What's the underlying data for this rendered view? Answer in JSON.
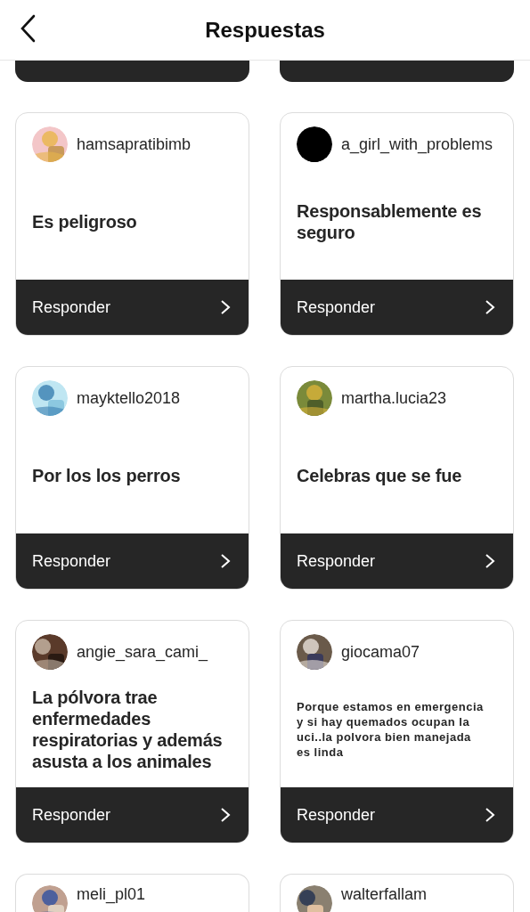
{
  "header": {
    "title": "Respuestas"
  },
  "cards": [
    {
      "kind": "cut_top"
    },
    {
      "kind": "cut_top"
    },
    {
      "kind": "short",
      "user": "hamsapratibimb",
      "answer": "Es peligroso",
      "action": "Responder"
    },
    {
      "kind": "short",
      "user": "a_girl_with_problems",
      "answer": "Responsablemente es seguro",
      "action": "Responder"
    },
    {
      "kind": "short",
      "user": "mayktello2018",
      "answer": "Por los los perros",
      "action": "Responder"
    },
    {
      "kind": "short",
      "user": "martha.lucia23",
      "answer": "Celebras que se fue",
      "action": "Responder"
    },
    {
      "kind": "short",
      "user": "angie_sara_cami_",
      "answer": "La pólvora trae enfermedades respiratorias y además asusta a los animales",
      "action": "Responder"
    },
    {
      "kind": "long",
      "user": "giocama07",
      "answer": "Porque estamos en emergencia y si hay quemados ocupan la uci..la polvora bien manejada es linda",
      "action": "Responder"
    },
    {
      "kind": "cut_bottom",
      "user": "meli_pl01"
    },
    {
      "kind": "cut_bottom",
      "user": "walterfallam"
    }
  ]
}
